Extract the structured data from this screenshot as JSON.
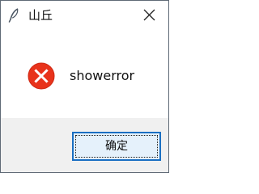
{
  "window": {
    "title": "山丘",
    "app_icon": "feather-icon",
    "close_icon": "close-icon"
  },
  "dialog": {
    "icon": "error-icon",
    "icon_color": "#e8331b",
    "message": "showerror",
    "ok_label": "确定"
  }
}
